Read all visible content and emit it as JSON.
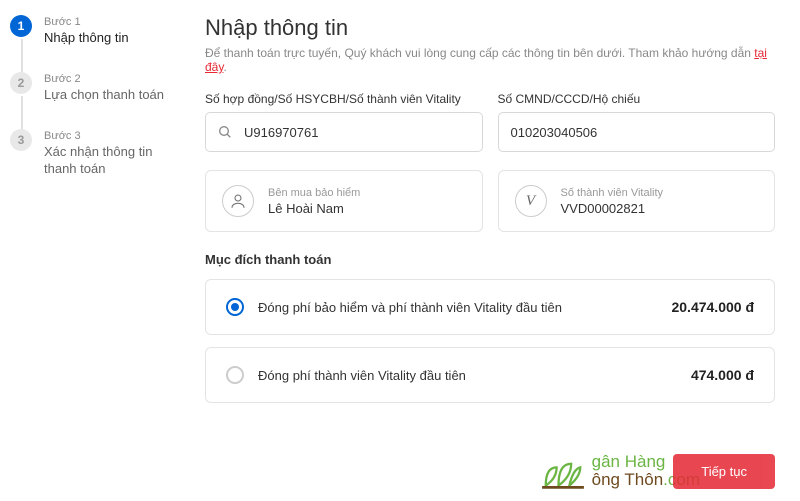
{
  "steps": [
    {
      "label": "Bước 1",
      "title": "Nhập thông tin"
    },
    {
      "label": "Bước 2",
      "title": "Lựa chọn thanh toán"
    },
    {
      "label": "Bước 3",
      "title": "Xác nhận thông tin thanh toán"
    }
  ],
  "page": {
    "title": "Nhập thông tin",
    "subtitle_pre": "Để thanh toán trực tuyến, Quý khách vui lòng cung cấp các thông tin bên dưới. Tham khảo hướng dẫn ",
    "subtitle_link": "tại đây",
    "subtitle_post": "."
  },
  "fields": {
    "contract_label": "Số hợp đồng/Số HSYCBH/Số thành viên Vitality",
    "contract_value": "U916970761",
    "id_label": "Số CMND/CCCD/Hộ chiếu",
    "id_value": "010203040506"
  },
  "info": {
    "buyer_label": "Bên mua bảo hiểm",
    "buyer_value": "Lê Hoài Nam",
    "vitality_label": "Số thành viên Vitality",
    "vitality_value": "VVD00002821"
  },
  "purpose": {
    "section_title": "Mục đích thanh toán",
    "options": [
      {
        "label": "Đóng phí bảo hiểm và phí thành viên Vitality đầu tiên",
        "price": "20.474.000 đ"
      },
      {
        "label": "Đóng phí thành viên Vitality đầu tiên",
        "price": "474.000 đ"
      }
    ]
  },
  "actions": {
    "continue": "Tiếp tục"
  },
  "watermark": {
    "line1": "gân Hàng",
    "line2": "ông Thôn",
    "suffix": ".com"
  }
}
